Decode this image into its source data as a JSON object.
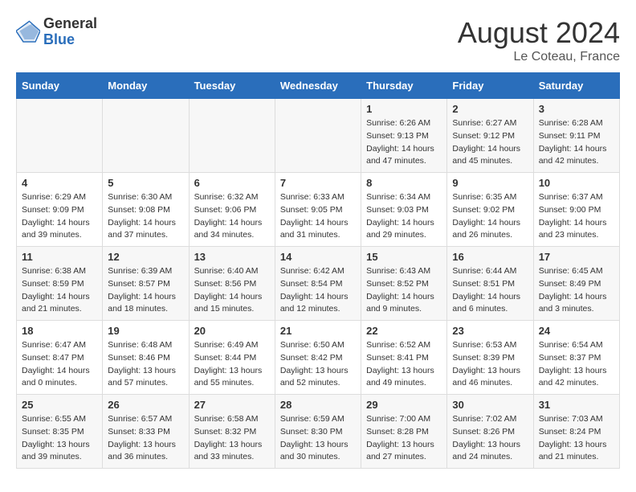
{
  "header": {
    "logo_general": "General",
    "logo_blue": "Blue",
    "title": "August 2024",
    "location": "Le Coteau, France"
  },
  "days_of_week": [
    "Sunday",
    "Monday",
    "Tuesday",
    "Wednesday",
    "Thursday",
    "Friday",
    "Saturday"
  ],
  "weeks": [
    [
      {
        "day": "",
        "info": ""
      },
      {
        "day": "",
        "info": ""
      },
      {
        "day": "",
        "info": ""
      },
      {
        "day": "",
        "info": ""
      },
      {
        "day": "1",
        "info": "Sunrise: 6:26 AM\nSunset: 9:13 PM\nDaylight: 14 hours and 47 minutes."
      },
      {
        "day": "2",
        "info": "Sunrise: 6:27 AM\nSunset: 9:12 PM\nDaylight: 14 hours and 45 minutes."
      },
      {
        "day": "3",
        "info": "Sunrise: 6:28 AM\nSunset: 9:11 PM\nDaylight: 14 hours and 42 minutes."
      }
    ],
    [
      {
        "day": "4",
        "info": "Sunrise: 6:29 AM\nSunset: 9:09 PM\nDaylight: 14 hours and 39 minutes."
      },
      {
        "day": "5",
        "info": "Sunrise: 6:30 AM\nSunset: 9:08 PM\nDaylight: 14 hours and 37 minutes."
      },
      {
        "day": "6",
        "info": "Sunrise: 6:32 AM\nSunset: 9:06 PM\nDaylight: 14 hours and 34 minutes."
      },
      {
        "day": "7",
        "info": "Sunrise: 6:33 AM\nSunset: 9:05 PM\nDaylight: 14 hours and 31 minutes."
      },
      {
        "day": "8",
        "info": "Sunrise: 6:34 AM\nSunset: 9:03 PM\nDaylight: 14 hours and 29 minutes."
      },
      {
        "day": "9",
        "info": "Sunrise: 6:35 AM\nSunset: 9:02 PM\nDaylight: 14 hours and 26 minutes."
      },
      {
        "day": "10",
        "info": "Sunrise: 6:37 AM\nSunset: 9:00 PM\nDaylight: 14 hours and 23 minutes."
      }
    ],
    [
      {
        "day": "11",
        "info": "Sunrise: 6:38 AM\nSunset: 8:59 PM\nDaylight: 14 hours and 21 minutes."
      },
      {
        "day": "12",
        "info": "Sunrise: 6:39 AM\nSunset: 8:57 PM\nDaylight: 14 hours and 18 minutes."
      },
      {
        "day": "13",
        "info": "Sunrise: 6:40 AM\nSunset: 8:56 PM\nDaylight: 14 hours and 15 minutes."
      },
      {
        "day": "14",
        "info": "Sunrise: 6:42 AM\nSunset: 8:54 PM\nDaylight: 14 hours and 12 minutes."
      },
      {
        "day": "15",
        "info": "Sunrise: 6:43 AM\nSunset: 8:52 PM\nDaylight: 14 hours and 9 minutes."
      },
      {
        "day": "16",
        "info": "Sunrise: 6:44 AM\nSunset: 8:51 PM\nDaylight: 14 hours and 6 minutes."
      },
      {
        "day": "17",
        "info": "Sunrise: 6:45 AM\nSunset: 8:49 PM\nDaylight: 14 hours and 3 minutes."
      }
    ],
    [
      {
        "day": "18",
        "info": "Sunrise: 6:47 AM\nSunset: 8:47 PM\nDaylight: 14 hours and 0 minutes."
      },
      {
        "day": "19",
        "info": "Sunrise: 6:48 AM\nSunset: 8:46 PM\nDaylight: 13 hours and 57 minutes."
      },
      {
        "day": "20",
        "info": "Sunrise: 6:49 AM\nSunset: 8:44 PM\nDaylight: 13 hours and 55 minutes."
      },
      {
        "day": "21",
        "info": "Sunrise: 6:50 AM\nSunset: 8:42 PM\nDaylight: 13 hours and 52 minutes."
      },
      {
        "day": "22",
        "info": "Sunrise: 6:52 AM\nSunset: 8:41 PM\nDaylight: 13 hours and 49 minutes."
      },
      {
        "day": "23",
        "info": "Sunrise: 6:53 AM\nSunset: 8:39 PM\nDaylight: 13 hours and 46 minutes."
      },
      {
        "day": "24",
        "info": "Sunrise: 6:54 AM\nSunset: 8:37 PM\nDaylight: 13 hours and 42 minutes."
      }
    ],
    [
      {
        "day": "25",
        "info": "Sunrise: 6:55 AM\nSunset: 8:35 PM\nDaylight: 13 hours and 39 minutes."
      },
      {
        "day": "26",
        "info": "Sunrise: 6:57 AM\nSunset: 8:33 PM\nDaylight: 13 hours and 36 minutes."
      },
      {
        "day": "27",
        "info": "Sunrise: 6:58 AM\nSunset: 8:32 PM\nDaylight: 13 hours and 33 minutes."
      },
      {
        "day": "28",
        "info": "Sunrise: 6:59 AM\nSunset: 8:30 PM\nDaylight: 13 hours and 30 minutes."
      },
      {
        "day": "29",
        "info": "Sunrise: 7:00 AM\nSunset: 8:28 PM\nDaylight: 13 hours and 27 minutes."
      },
      {
        "day": "30",
        "info": "Sunrise: 7:02 AM\nSunset: 8:26 PM\nDaylight: 13 hours and 24 minutes."
      },
      {
        "day": "31",
        "info": "Sunrise: 7:03 AM\nSunset: 8:24 PM\nDaylight: 13 hours and 21 minutes."
      }
    ]
  ]
}
